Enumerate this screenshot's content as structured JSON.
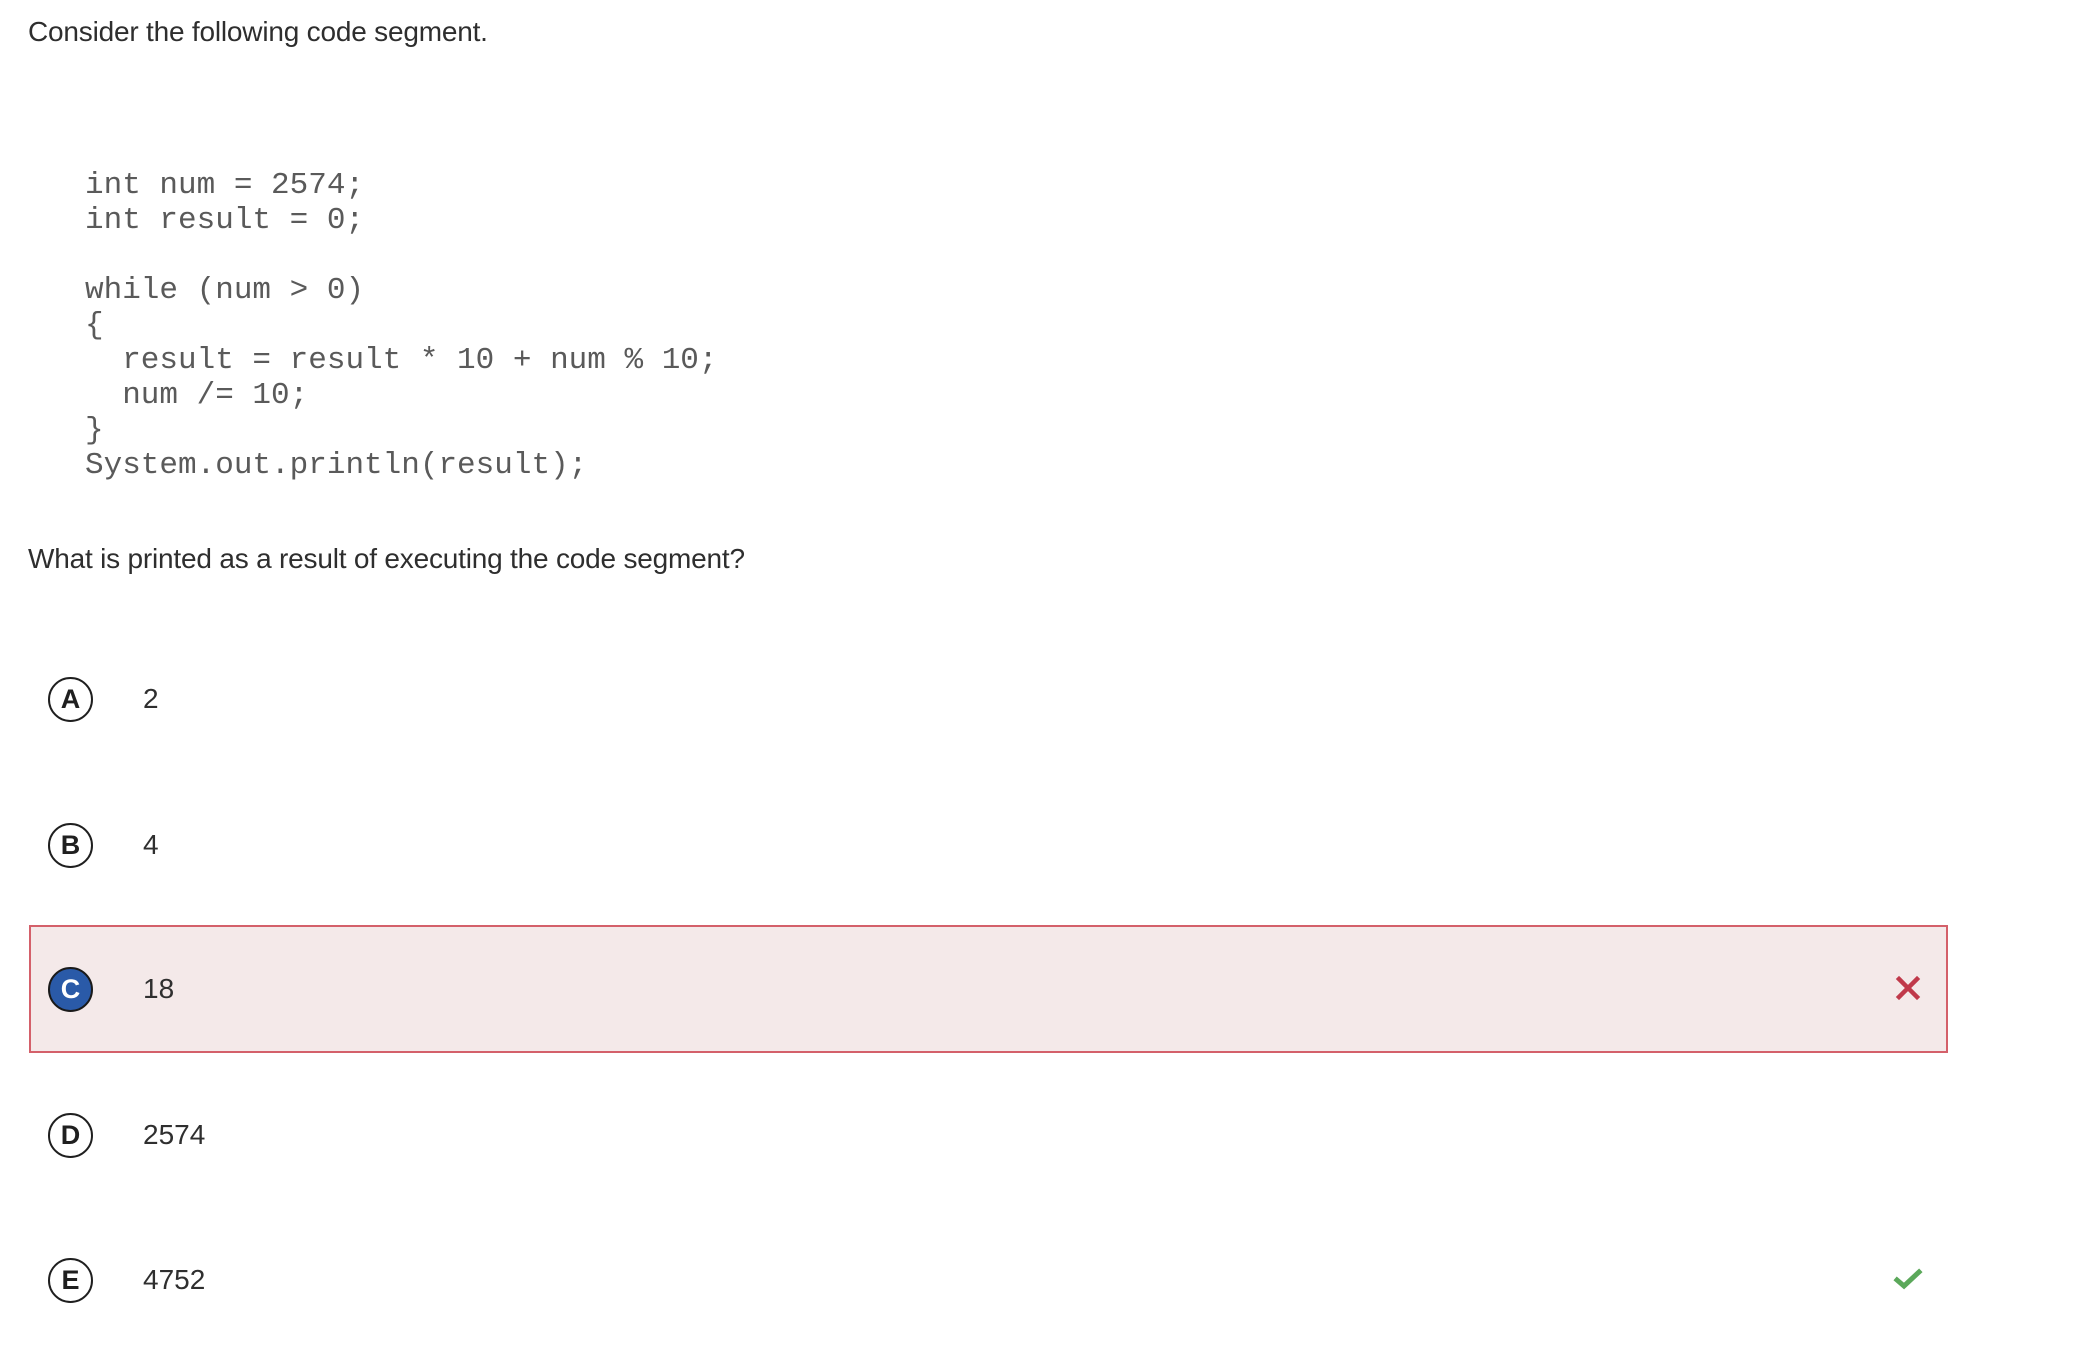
{
  "prompt": {
    "intro": "Consider the following code segment.",
    "question": "What is printed as a result of executing the code segment?"
  },
  "code": {
    "lines": [
      "int num = 2574;",
      "int result = 0;",
      "",
      "while (num > 0)",
      "{",
      "  result = result * 10 + num % 10;",
      "  num /= 10;",
      "}",
      "System.out.println(result);"
    ]
  },
  "options": [
    {
      "letter": "A",
      "value": "2",
      "state": "default",
      "status_icon": ""
    },
    {
      "letter": "B",
      "value": "4",
      "state": "default",
      "status_icon": ""
    },
    {
      "letter": "C",
      "value": "18",
      "state": "selected-incorrect",
      "status_icon": "x-icon"
    },
    {
      "letter": "D",
      "value": "2574",
      "state": "default",
      "status_icon": ""
    },
    {
      "letter": "E",
      "value": "4752",
      "state": "correct",
      "status_icon": "check-icon"
    }
  ],
  "colors": {
    "selected_badge": "#2a5aa8",
    "incorrect_border": "#d4606a",
    "incorrect_background": "#f4e9e9",
    "incorrect_icon": "#c0394a",
    "correct_icon": "#5ba85a"
  }
}
